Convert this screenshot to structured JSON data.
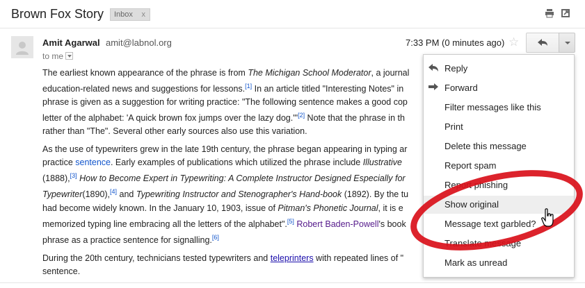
{
  "header": {
    "subject": "Brown Fox Story",
    "label": "Inbox",
    "label_close": "x"
  },
  "message": {
    "sender_name": "Amit Agarwal",
    "sender_email": "amit@labnol.org",
    "to_label": "to me",
    "timestamp": "7:33 PM (0 minutes ago)"
  },
  "body": {
    "p1": {
      "a": "The earliest known appearance of the phrase is from ",
      "b": "The Michigan School Moderator",
      "c": ", a journal ",
      "d": "education-related news and suggestions for lessons.",
      "ref1": "[1]",
      "e": " In an article titled \"Interesting Notes\" in",
      "f": "phrase is given as a suggestion for writing practice: \"The following sentence makes a good cop",
      "g": "letter of the alphabet: 'A quick brown fox jumps over the lazy dog.'\"",
      "ref2": "[2]",
      "h": " Note that the phrase in th",
      "i": "rather than \"The\". Several other early sources also use this variation."
    },
    "p2": {
      "a": "As the use of typewriters grew in the late 19th century, the phrase began appearing in typing ar",
      "b": "practice ",
      "b_link": "sentence",
      "c": ". Early examples of publications which utilized the phrase include ",
      "c_i": "Illustrative",
      "d": "(1888),",
      "ref3": "[3]",
      "d_i": " How to Become Expert in Typewriting: A Complete Instructor Designed Especially for",
      "e_i": "Typewriter",
      "e": "(1890),",
      "ref4": "[4]",
      "e2": " and ",
      "e2_i": "Typewriting Instructor and Stenographer's Hand-book",
      "e3": " (1892). By the tu",
      "f": "had become widely known. In the January 10, 1903, issue of ",
      "f_i": "Pitman's Phonetic Journal",
      "f2": ", it is e",
      "g": "memorized typing line embracing all the letters of the alphabet\".",
      "ref5": "[5]",
      "g_link": "Robert Baden-Powell",
      "g2": "'s book",
      "h": "phrase as a practice sentence for signalling.",
      "ref6": "[6]"
    },
    "p3": {
      "a": "During the 20th century, technicians tested typewriters and ",
      "a_link": "teleprinters",
      "b": " with repeated lines of \"",
      "c": "sentence."
    }
  },
  "menu": {
    "items": [
      {
        "label": "Reply",
        "icon": "reply-icon"
      },
      {
        "label": "Forward",
        "icon": "forward-icon"
      },
      {
        "label": "Filter messages like this"
      },
      {
        "label": "Print"
      },
      {
        "label": "Delete this message"
      },
      {
        "label": "Report spam"
      },
      {
        "label": "Report phishing"
      },
      {
        "label": "Show original"
      },
      {
        "label": "Message text garbled?"
      },
      {
        "label": "Translate message"
      },
      {
        "label": "Mark as unread"
      }
    ],
    "highlighted_index": 7
  },
  "colors": {
    "annotation_ring": "#d9101a",
    "link": "#1155cc",
    "menu_highlight": "#eeeeee"
  }
}
